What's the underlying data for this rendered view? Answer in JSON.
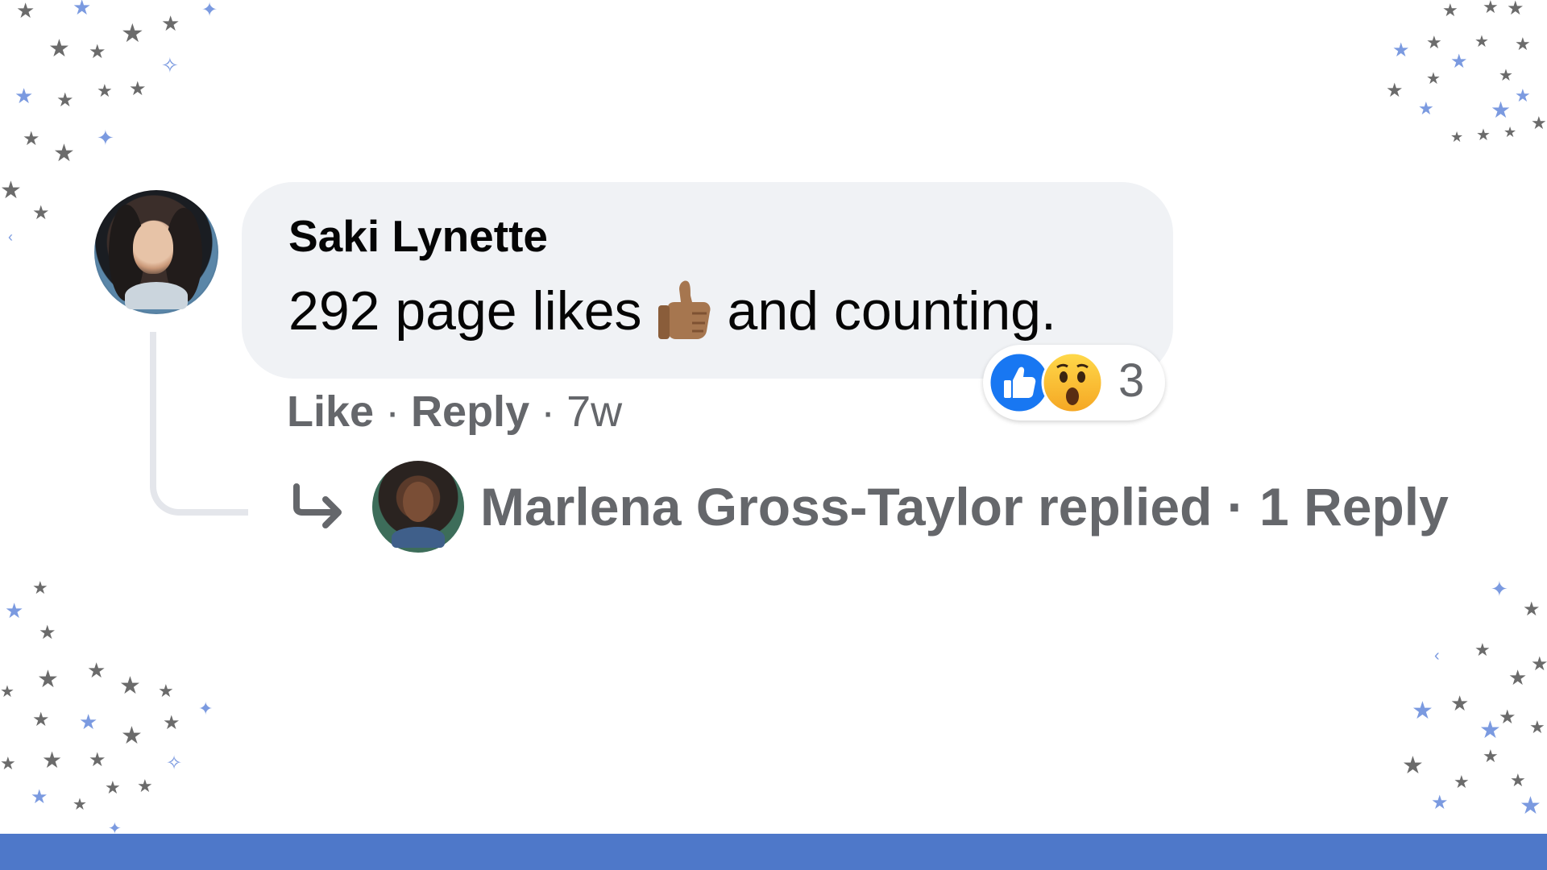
{
  "comment": {
    "author": "Saki Lynette",
    "text_before": "292 page likes",
    "emoji": "thumbs-up-medium-skin",
    "text_after": "and counting.",
    "reactions": {
      "types": [
        "like-reaction-icon",
        "wow-reaction-icon"
      ],
      "count": "3"
    },
    "actions": {
      "like": "Like",
      "separator": "·",
      "reply": "Reply",
      "time": "7w"
    }
  },
  "reply_summary": {
    "text": "Marlena Gross-Taylor replied · 1 Reply"
  },
  "colors": {
    "bubble": "#f0f2f5",
    "muted_text": "#65676b",
    "like_blue": "#1877f2",
    "bottom_bar": "#4e78c9",
    "star_gray": "#6b6b6b",
    "star_blue": "#7b9ae0"
  }
}
